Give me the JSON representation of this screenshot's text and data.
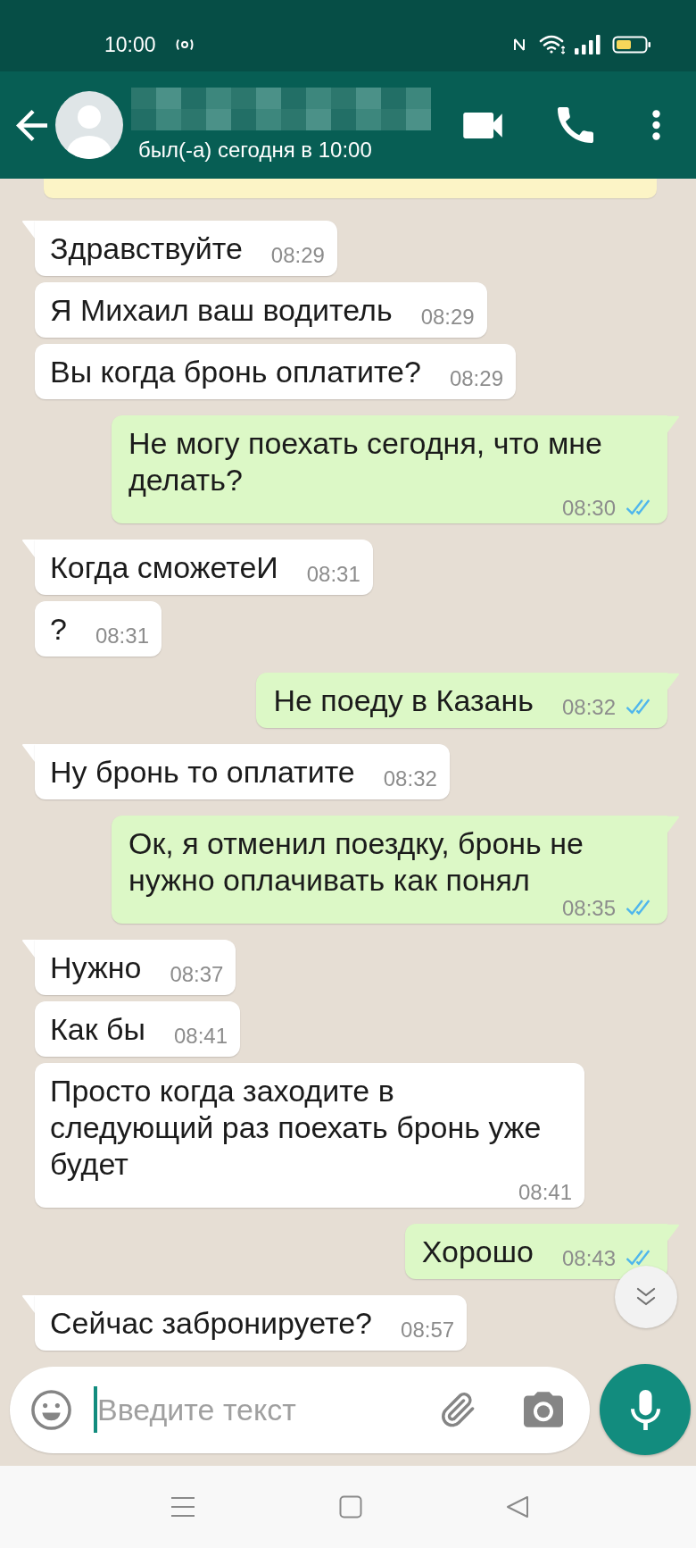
{
  "status_bar": {
    "time": "10:00"
  },
  "header": {
    "status": "был(-а) сегодня в 10:00"
  },
  "messages": [
    {
      "kind": "incoming",
      "text": "Здравствуйте",
      "time": "08:29"
    },
    {
      "kind": "incoming",
      "text": "Я Михаил ваш водитель",
      "time": "08:29"
    },
    {
      "kind": "incoming",
      "text": "Вы когда бронь оплатите?",
      "time": "08:29"
    },
    {
      "kind": "outgoing",
      "text": "Не могу поехать сегодня, что мне\nделать?",
      "time": "08:30",
      "read": true
    },
    {
      "kind": "incoming",
      "text": "Когда сможетеИ",
      "time": "08:31"
    },
    {
      "kind": "incoming",
      "text": "?",
      "time": "08:31"
    },
    {
      "kind": "outgoing",
      "text": "Не поеду в Казань",
      "time": "08:32",
      "read": true
    },
    {
      "kind": "incoming",
      "text": "Ну бронь то оплатите",
      "time": "08:32"
    },
    {
      "kind": "outgoing",
      "text": "Ок, я отменил поездку, бронь не\nнужно оплачивать как понял",
      "time": "08:35",
      "read": true
    },
    {
      "kind": "incoming",
      "text": "Нужно",
      "time": "08:37"
    },
    {
      "kind": "incoming",
      "text": "Как бы",
      "time": "08:41"
    },
    {
      "kind": "incoming",
      "text": "Просто когда заходите в\nследующий раз поехать бронь уже\nбудет",
      "time": "08:41"
    },
    {
      "kind": "outgoing",
      "text": "Хорошо",
      "time": "08:43",
      "read": true
    },
    {
      "kind": "incoming",
      "text": "Сейчас забронируете?",
      "time": "08:57"
    }
  ],
  "composer": {
    "placeholder": "Введите текст"
  }
}
